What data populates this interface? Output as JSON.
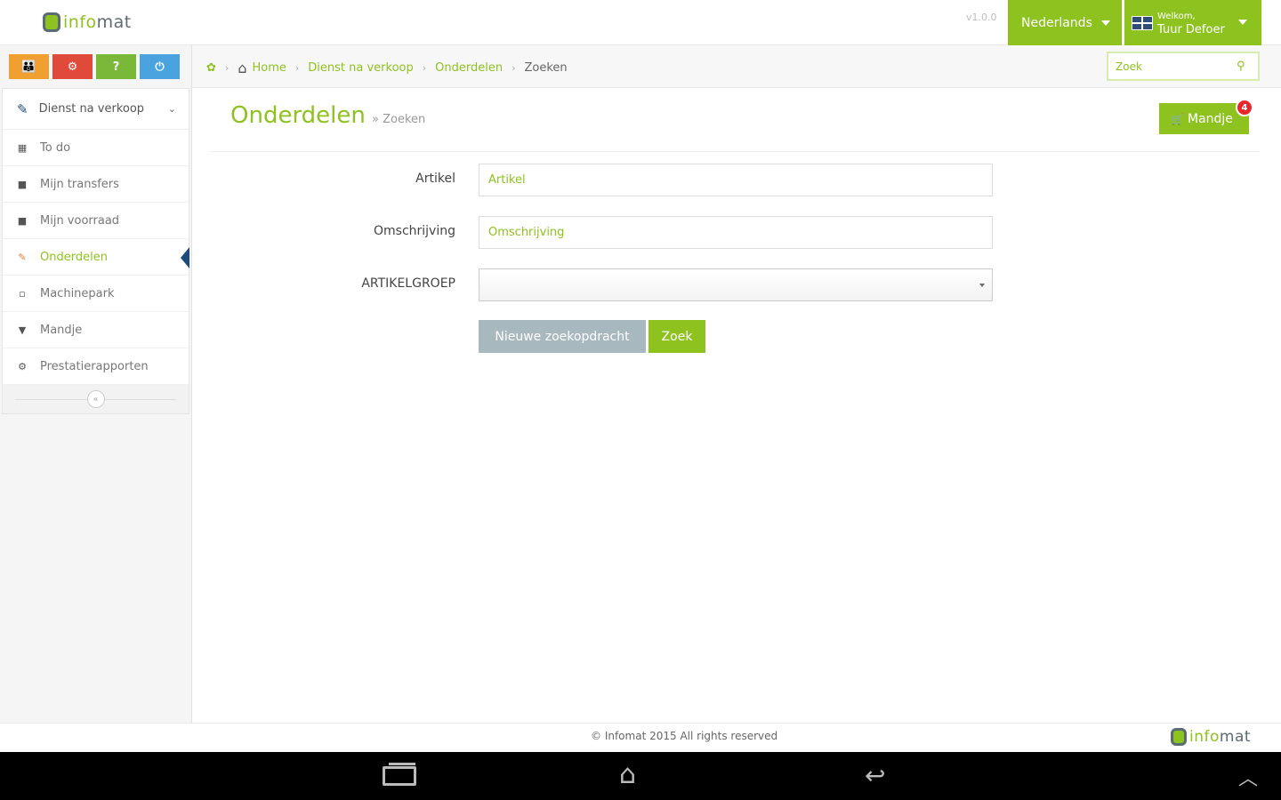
{
  "app": {
    "logo_text_a": "info",
    "logo_text_b": "mat",
    "version": "v1.0.0"
  },
  "navbar": {
    "language": "Nederlands",
    "welcome": "Welkom,",
    "user_name": "Tuur Defoer"
  },
  "shortcuts": [
    {
      "icon": "users-icon",
      "glyph": "👪",
      "color": "#f0a030"
    },
    {
      "icon": "cogs-icon",
      "glyph": "⚙",
      "color": "#e04a3a"
    },
    {
      "icon": "help-icon",
      "glyph": "?",
      "color": "#7ab83a"
    },
    {
      "icon": "power-icon",
      "glyph": "⏻",
      "color": "#4aa3df"
    }
  ],
  "sidebar": {
    "section_label": "Dienst na verkoop",
    "items": [
      {
        "label": "To do",
        "icon": "calendar-icon",
        "glyph": "▦"
      },
      {
        "label": "Mijn transfers",
        "icon": "truck-icon",
        "glyph": "■"
      },
      {
        "label": "Mijn voorraad",
        "icon": "briefcase-icon",
        "glyph": "■"
      },
      {
        "label": "Onderdelen",
        "icon": "wrench-icon",
        "glyph": "✎",
        "active": true
      },
      {
        "label": "Machinepark",
        "icon": "machine-icon",
        "glyph": "▫"
      },
      {
        "label": "Mandje",
        "icon": "cart-icon",
        "glyph": "▼"
      },
      {
        "label": "Prestatierapporten",
        "icon": "cogs-icon",
        "glyph": "⚙"
      }
    ],
    "collapse_glyph": "«"
  },
  "breadcrumb": {
    "home": "Home",
    "items": [
      "Dienst na verkoop",
      "Onderdelen"
    ],
    "current": "Zoeken"
  },
  "search": {
    "placeholder": "Zoek"
  },
  "page": {
    "title": "Onderdelen",
    "subtitle": "» Zoeken",
    "cart_label": "Mandje",
    "cart_count": "4"
  },
  "form": {
    "artikel_label": "Artikel",
    "artikel_placeholder": "Artikel",
    "omschrijving_label": "Omschrijving",
    "omschrijving_placeholder": "Omschrijving",
    "artikelgroep_label": "ARTIKELGROEP",
    "artikelgroep_value": "",
    "reset_label": "Nieuwe zoekopdracht",
    "search_label": "Zoek"
  },
  "footer": {
    "copyright": "© Infomat 2015 All rights reserved"
  },
  "colors": {
    "brand_green": "#8dc21f",
    "badge_red": "#e8262b",
    "active_marker": "#1d4a7a"
  }
}
